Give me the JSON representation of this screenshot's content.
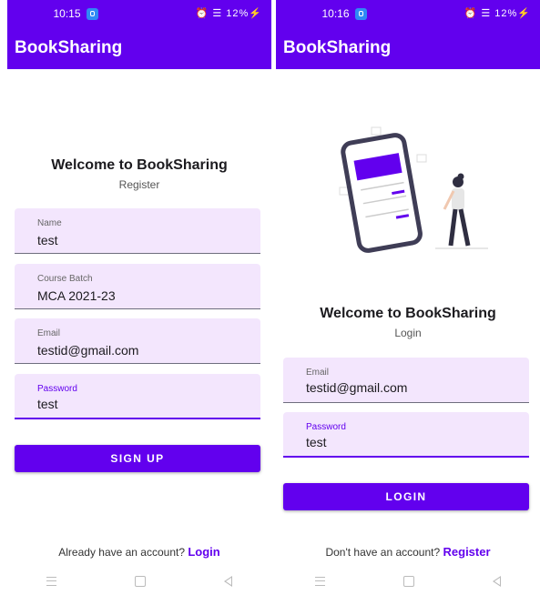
{
  "register_screen": {
    "status": {
      "time": "10:15",
      "battery": "12%"
    },
    "appbar_title": "BookSharing",
    "heading": "Welcome to BookSharing",
    "subheading": "Register",
    "fields": [
      {
        "label": "Name",
        "value": "test"
      },
      {
        "label": "Course Batch",
        "value": "MCA 2021-23"
      },
      {
        "label": "Email",
        "value": "testid@gmail.com"
      },
      {
        "label": "Password",
        "value": "test"
      }
    ],
    "submit_label": "SIGN UP",
    "footer_text": "Already have an account?",
    "footer_link": "Login"
  },
  "login_screen": {
    "status": {
      "time": "10:16",
      "battery": "12%"
    },
    "appbar_title": "BookSharing",
    "heading": "Welcome to BookSharing",
    "subheading": "Login",
    "fields": [
      {
        "label": "Email",
        "value": "testid@gmail.com"
      },
      {
        "label": "Password",
        "value": "test"
      }
    ],
    "submit_label": "LOGIN",
    "footer_text": "Don't have an account?",
    "footer_link": "Register"
  },
  "colors": {
    "primary": "#6200ee",
    "field_bg": "#f3e6fd"
  },
  "icons": [
    "nav-menu-icon",
    "nav-home-icon",
    "nav-back-icon",
    "notification-badge-icon"
  ]
}
